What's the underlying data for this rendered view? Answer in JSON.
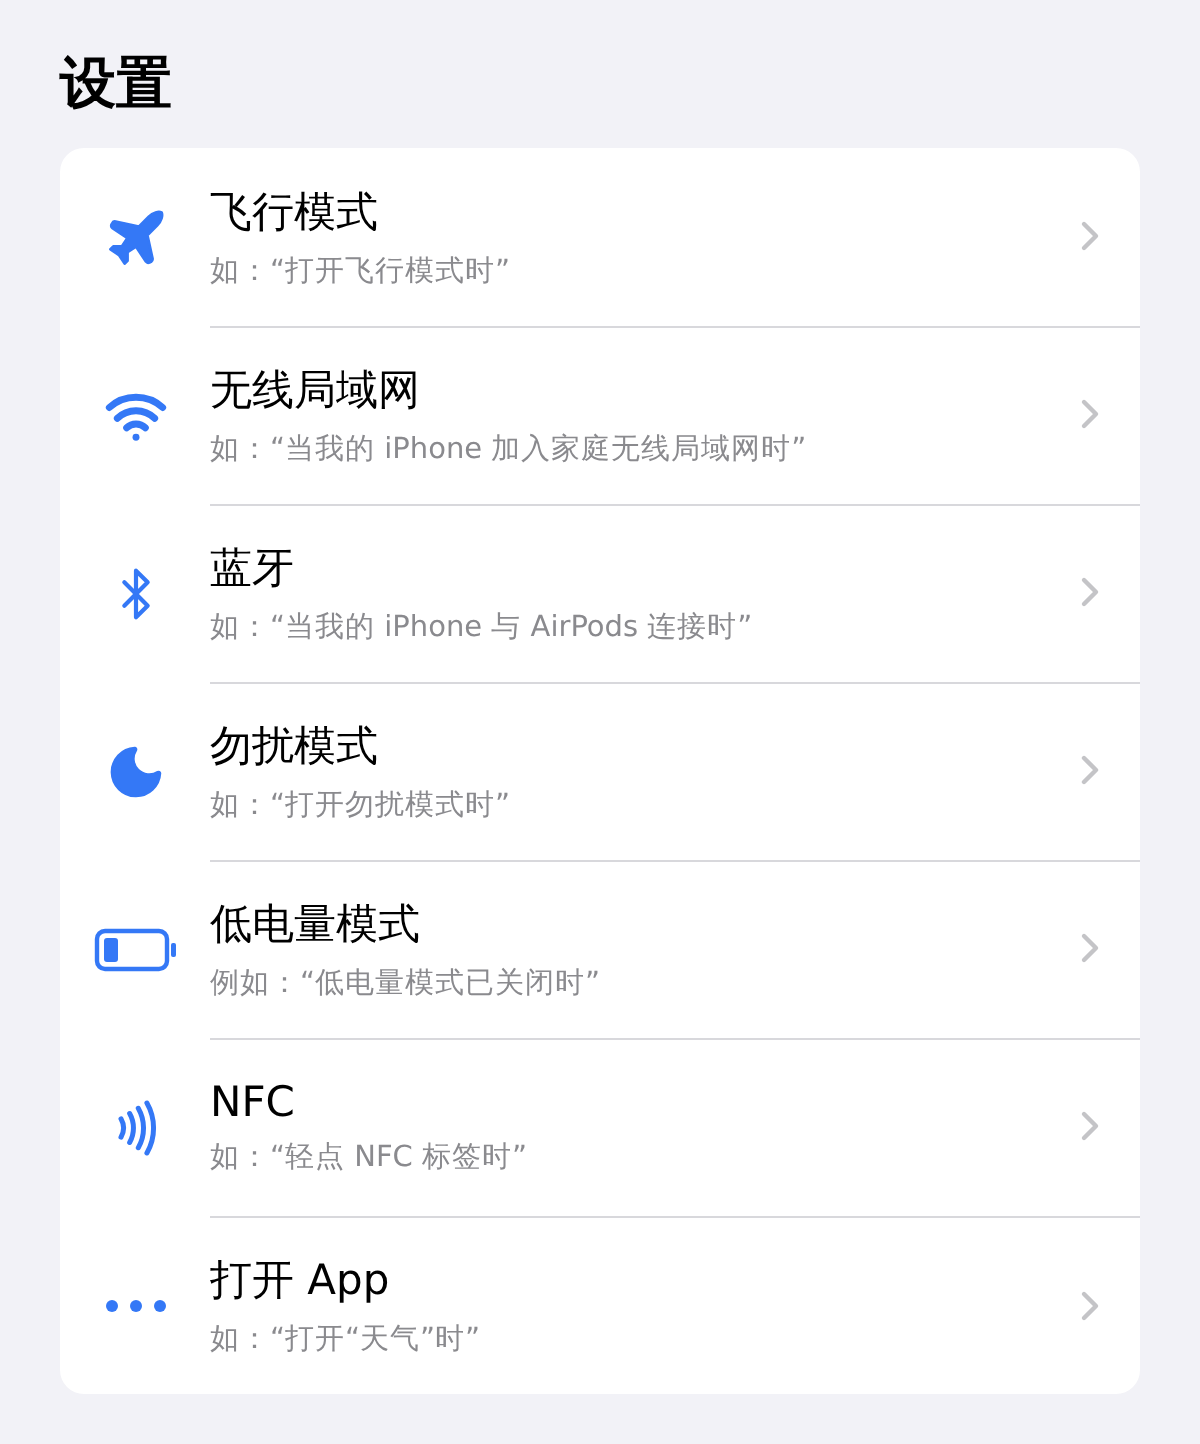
{
  "title": "设置",
  "items": [
    {
      "kind": "airplane",
      "title": "飞行模式",
      "subtitle": "如：“打开飞行模式时”"
    },
    {
      "kind": "wifi",
      "title": "无线局域网",
      "subtitle": "如：“当我的 iPhone 加入家庭无线局域网时”"
    },
    {
      "kind": "bluetooth",
      "title": "蓝牙",
      "subtitle": "如：“当我的 iPhone 与 AirPods 连接时”"
    },
    {
      "kind": "moon",
      "title": "勿扰模式",
      "subtitle": "如：“打开勿扰模式时”"
    },
    {
      "kind": "battery",
      "title": "低电量模式",
      "subtitle": "例如：“低电量模式已关闭时”"
    },
    {
      "kind": "nfc",
      "title": "NFC",
      "subtitle": "如：“轻点 NFC 标签时”"
    },
    {
      "kind": "more",
      "title": "打开 App",
      "subtitle": "如：“打开“天气”时”"
    }
  ]
}
